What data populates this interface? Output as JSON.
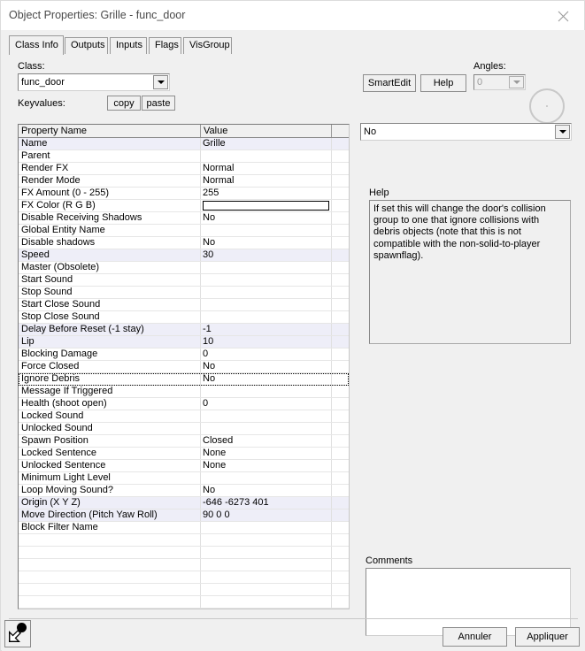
{
  "window": {
    "title": "Object Properties: Grille - func_door",
    "close_icon": "close-icon"
  },
  "tabs": [
    {
      "label": "Class Info",
      "active": true
    },
    {
      "label": "Outputs",
      "active": false
    },
    {
      "label": "Inputs",
      "active": false
    },
    {
      "label": "Flags",
      "active": false
    },
    {
      "label": "VisGroup",
      "active": false
    }
  ],
  "class_section": {
    "class_label": "Class:",
    "class_value": "func_door",
    "keyvalues_label": "Keyvalues:",
    "copy_label": "copy",
    "paste_label": "paste"
  },
  "toolbar": {
    "smartedit_label": "SmartEdit",
    "help_label": "Help",
    "angles_label": "Angles:",
    "angles_value": "0"
  },
  "value_editor": {
    "current_value": "No"
  },
  "grid": {
    "columns": [
      "Property Name",
      "Value"
    ],
    "rows": [
      {
        "name": "Name",
        "value": "Grille",
        "alt": true
      },
      {
        "name": "Parent",
        "value": "",
        "alt": false
      },
      {
        "name": "Render FX",
        "value": "Normal",
        "alt": false
      },
      {
        "name": "Render Mode",
        "value": "Normal",
        "alt": false
      },
      {
        "name": "FX Amount (0 - 255)",
        "value": "255",
        "alt": false
      },
      {
        "name": "FX Color (R G B)",
        "value": "",
        "alt": false,
        "swatch": "#ffffff"
      },
      {
        "name": "Disable Receiving Shadows",
        "value": "No",
        "alt": false
      },
      {
        "name": "Global Entity Name",
        "value": "",
        "alt": false
      },
      {
        "name": "Disable shadows",
        "value": "No",
        "alt": false
      },
      {
        "name": "Speed",
        "value": "30",
        "alt": true
      },
      {
        "name": "Master (Obsolete)",
        "value": "",
        "alt": false
      },
      {
        "name": "Start Sound",
        "value": "",
        "alt": false
      },
      {
        "name": "Stop Sound",
        "value": "",
        "alt": false
      },
      {
        "name": "Start Close Sound",
        "value": "",
        "alt": false
      },
      {
        "name": "Stop Close Sound",
        "value": "",
        "alt": false
      },
      {
        "name": "Delay Before Reset (-1 stay)",
        "value": "-1",
        "alt": true
      },
      {
        "name": "Lip",
        "value": "10",
        "alt": true
      },
      {
        "name": "Blocking Damage",
        "value": "0",
        "alt": false
      },
      {
        "name": "Force Closed",
        "value": "No",
        "alt": false
      },
      {
        "name": "Ignore Debris",
        "value": "No",
        "alt": false,
        "selected": true
      },
      {
        "name": "Message If Triggered",
        "value": "",
        "alt": false
      },
      {
        "name": "Health (shoot open)",
        "value": "0",
        "alt": false
      },
      {
        "name": "Locked Sound",
        "value": "",
        "alt": false
      },
      {
        "name": "Unlocked Sound",
        "value": "",
        "alt": false
      },
      {
        "name": "Spawn Position",
        "value": "Closed",
        "alt": false
      },
      {
        "name": "Locked Sentence",
        "value": "None",
        "alt": false
      },
      {
        "name": "Unlocked Sentence",
        "value": "None",
        "alt": false
      },
      {
        "name": "Minimum Light Level",
        "value": "",
        "alt": false
      },
      {
        "name": "Loop Moving Sound?",
        "value": "No",
        "alt": false
      },
      {
        "name": "Origin (X Y Z)",
        "value": "-646 -6273 401",
        "alt": true
      },
      {
        "name": "Move Direction (Pitch Yaw Roll)",
        "value": "90 0 0",
        "alt": true
      },
      {
        "name": "Block Filter Name",
        "value": "",
        "alt": false
      },
      {
        "name": "",
        "value": "",
        "alt": false
      },
      {
        "name": "",
        "value": "",
        "alt": false
      },
      {
        "name": "",
        "value": "",
        "alt": false
      },
      {
        "name": "",
        "value": "",
        "alt": false
      },
      {
        "name": "",
        "value": "",
        "alt": false
      },
      {
        "name": "",
        "value": "",
        "alt": false
      }
    ]
  },
  "help_panel": {
    "label": "Help",
    "text": "If set this will change the door's collision group to one that ignore collisions with debris objects (note that this is not compatible with the non-solid-to-player spawnflag)."
  },
  "comments_panel": {
    "label": "Comments",
    "value": ""
  },
  "footer": {
    "pick_icon": "entity-picker-icon",
    "cancel_label": "Annuler",
    "apply_label": "Appliquer"
  },
  "colors": {
    "dialog_bg": "#f0f0f0",
    "field_bg": "#ffffff",
    "alt_row": "#eeeef8",
    "title_text": "#4a4a4a"
  }
}
